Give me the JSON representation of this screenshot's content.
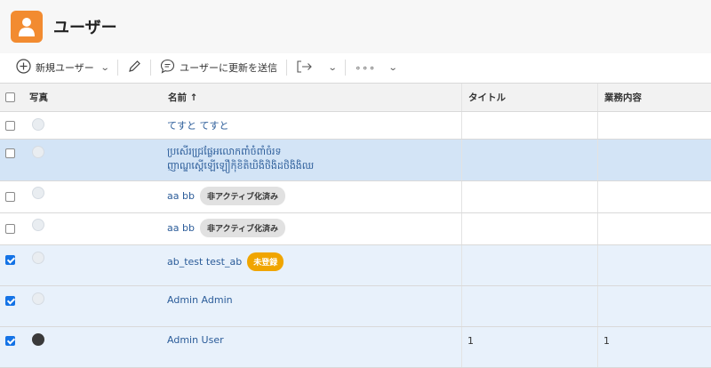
{
  "header": {
    "title": "ユーザー"
  },
  "toolbar": {
    "new_user": "新規ユーザー",
    "send_update": "ユーザーに更新を送信",
    "more": "∘∘∘"
  },
  "columns": {
    "photo": "写真",
    "name": "名前 ↑",
    "title": "タイトル",
    "duty": "業務内容"
  },
  "rows": [
    {
      "name": "てすと てすと",
      "badge": "",
      "title": "",
      "duty": "",
      "checked": false
    },
    {
      "name_line1": "ប្រសើរជ្រ្រផ្លែអលោកពាំចំពាំចំរទ",
      "name_line2": "ញាណ្ឌស្តើឡើឡឿកុិខិតិឃិងិថិងិដថិងិងិឈ",
      "title": "",
      "duty": "",
      "checked": false
    },
    {
      "name": "aa bb",
      "badge": "非アクティブ化済み",
      "title": "",
      "duty": "",
      "checked": false
    },
    {
      "name": "aa bb",
      "badge": "非アクティブ化済み",
      "title": "",
      "duty": "",
      "checked": false
    },
    {
      "name": "ab_test test_ab",
      "badge": "未登録",
      "title": "",
      "duty": "",
      "checked": true
    },
    {
      "name": "Admin Admin",
      "badge": "",
      "title": "",
      "duty": "",
      "checked": true
    },
    {
      "name": "Admin User",
      "badge": "",
      "title": "1",
      "duty": "1",
      "checked": true
    }
  ],
  "colors": {
    "accent": "#f28b30",
    "link": "#2b5c99",
    "selected_row": "#e8f1fb",
    "unregistered": "#f0a500"
  }
}
